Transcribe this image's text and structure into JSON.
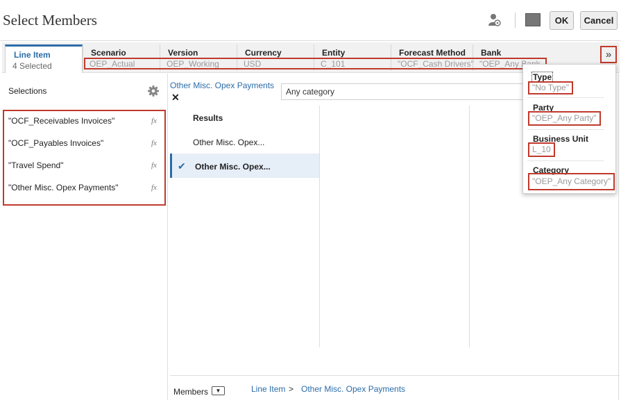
{
  "title": "Select Members",
  "toolbar": {
    "ok_label": "OK",
    "cancel_label": "Cancel"
  },
  "active_tab": {
    "label": "Line Item",
    "sub": "4 Selected"
  },
  "dimensions": [
    {
      "name": "Scenario",
      "value": "OEP_Actual"
    },
    {
      "name": "Version",
      "value": "OEP_Working"
    },
    {
      "name": "Currency",
      "value": "USD"
    },
    {
      "name": "Entity",
      "value": "C_101"
    },
    {
      "name": "Forecast Method",
      "value": "\"OCF_Cash Drivers\""
    },
    {
      "name": "Bank",
      "value": "\"OEP_Any Bank\""
    }
  ],
  "overflow": [
    {
      "name": "Type",
      "value": "\"No Type\""
    },
    {
      "name": "Party",
      "value": "\"OEP_Any Party\""
    },
    {
      "name": "Business Unit",
      "value": "L_10"
    },
    {
      "name": "Category",
      "value": "\"OEP_Any Category\""
    }
  ],
  "selections": {
    "title": "Selections",
    "items": [
      "\"OCF_Receivables Invoices\"",
      "\"OCF_Payables Invoices\"",
      "\"Travel Spend\"",
      "\"Other Misc. Opex Payments\""
    ],
    "fx_label": "fx"
  },
  "search": {
    "crumb": "Other Misc. Opex Payments",
    "value": "Any category"
  },
  "results": {
    "title": "Results",
    "item": "Other Misc. Opex...",
    "selected": "Other Misc. Opex..."
  },
  "bottom": {
    "members_label": "Members",
    "breadcrumb": [
      "Line Item",
      "Other Misc. Opex Payments"
    ]
  }
}
